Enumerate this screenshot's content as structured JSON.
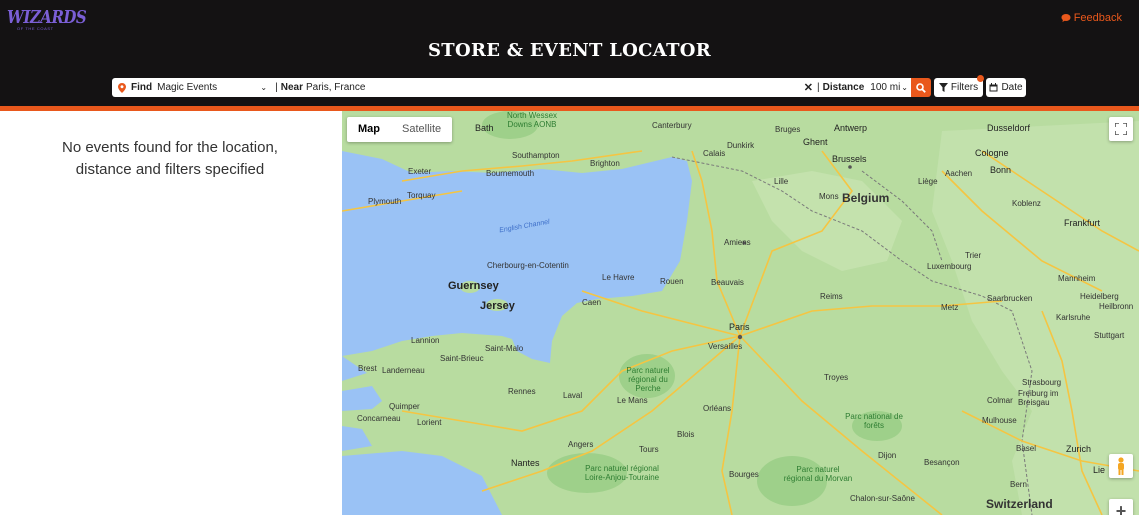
{
  "brand": {
    "logo_main": "WIZARDS",
    "logo_sub": "OF THE COAST"
  },
  "header": {
    "title": "STORE & EVENT LOCATOR",
    "feedback_label": "Feedback"
  },
  "search": {
    "find_label": "Find",
    "find_value": "Magic Events",
    "near_label": "Near",
    "near_value": "Paris, France",
    "separator": "|",
    "distance_label": "Distance",
    "distance_value": "100 mi",
    "filters_label": "Filters",
    "date_label": "Date"
  },
  "results": {
    "message_line1": "No events found for the location,",
    "message_line2": "distance and filters specified"
  },
  "map": {
    "type_buttons": {
      "map": "Map",
      "satellite": "Satellite"
    },
    "zoom_in": "+",
    "colors": {
      "sea": "#9ac2f5",
      "land": "#b8dca0",
      "road": "#f5c542",
      "border": "#7a7a7a"
    },
    "labels": {
      "bath": "Bath",
      "north_wessex": "North Wessex Downs AONB",
      "canterbury": "Canterbury",
      "bruges": "Bruges",
      "antwerp": "Antwerp",
      "dusseldorf": "Dusseldorf",
      "dunkirk": "Dunkirk",
      "ghent": "Ghent",
      "southampton": "Southampton",
      "brighton": "Brighton",
      "calais": "Calais",
      "brussels": "Brussels",
      "cologne": "Cologne",
      "exeter": "Exeter",
      "bournemouth": "Bournemouth",
      "lille": "Lille",
      "aachen": "Aachen",
      "bonn": "Bonn",
      "torquay": "Torquay",
      "mons": "Mons",
      "belgium": "Belgium",
      "liege": "Liège",
      "plymouth": "Plymouth",
      "koblenz": "Koblenz",
      "english_channel": "English Channel",
      "frankfurt": "Frankfurt",
      "amiens": "Amiens",
      "cherbourg": "Cherbourg-en-Cotentin",
      "luxembourg": "Luxembourg",
      "mannheim": "Mannheim",
      "trier": "Trier",
      "le_havre": "Le Havre",
      "rouen": "Rouen",
      "guernsey": "Guernsey",
      "beauvais": "Beauvais",
      "reims": "Reims",
      "saarbrucken": "Saarbrucken",
      "heidelberg": "Heidelberg",
      "caen": "Caen",
      "jersey": "Jersey",
      "metz": "Metz",
      "karlsruhe": "Karlsruhe",
      "heilbronn": "Heilbronn",
      "paris": "Paris",
      "versailles": "Versailles",
      "lannion": "Lannion",
      "saint_brieuc": "Saint-Brieuc",
      "saint_malo": "Saint-Malo",
      "stuttgart": "Stuttgart",
      "brest": "Brest",
      "landerneau": "Landerneau",
      "parc_perche": "Parc naturel régional du Perche",
      "troyes": "Troyes",
      "rennes": "Rennes",
      "laval": "Laval",
      "le_mans": "Le Mans",
      "strasbourg": "Strasbourg",
      "freiburg": "Freiburg im Breisgau",
      "quimper": "Quimper",
      "colmar": "Colmar",
      "orleans": "Orléans",
      "parc_forets": "Parc national de forêts",
      "mulhouse": "Mulhouse",
      "concarneau": "Concarneau",
      "lorient": "Lorient",
      "angers": "Angers",
      "blois": "Blois",
      "tours": "Tours",
      "basel": "Basel",
      "zurich": "Zurich",
      "dijon": "Dijon",
      "nantes": "Nantes",
      "parc_loire": "Parc naturel régional Loire-Anjou-Touraine",
      "besancon": "Besançon",
      "bourges": "Bourges",
      "parc_morvan": "Parc naturel régional du Morvan",
      "chalon": "Chalon-sur-Saône",
      "bern": "Bern",
      "switzerland": "Switzerland",
      "lie": "Lie"
    }
  }
}
